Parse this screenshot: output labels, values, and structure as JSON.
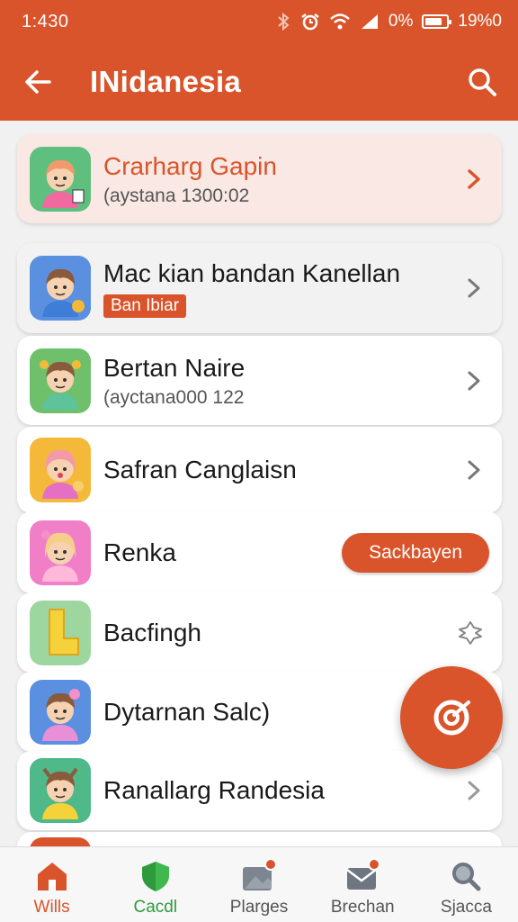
{
  "status_bar": {
    "time": "1:430",
    "battery_percent_label": "0%",
    "signal_label": "19%0",
    "icons": [
      "bluetooth-icon",
      "alarm-icon",
      "wifi-icon",
      "signal-icon",
      "battery-icon"
    ]
  },
  "header": {
    "title": "INidanesia",
    "back_icon": "arrow-left-icon",
    "search_icon": "search-icon"
  },
  "colors": {
    "accent": "#d9542b",
    "highlight_row": "#f9e8e3",
    "green": "#2f9a3c"
  },
  "list": {
    "items": [
      {
        "name": "Crarharg Gapin",
        "subtitle": "(aystana 1300:02",
        "trailing": "chevron-right-icon"
      },
      {
        "name": "Mac kian bandan Kanellan",
        "badge": "Ban Ibiar",
        "trailing": "chevron-right-icon"
      },
      {
        "name": "Bertan Naire",
        "subtitle": "(ayctana000 122",
        "trailing": "chevron-right-icon"
      },
      {
        "name": "Safran Canglaisn",
        "trailing": "chevron-right-icon"
      },
      {
        "name": "Renka",
        "action_label": "Sackbayen"
      },
      {
        "name": "Bacfingh",
        "trailing": "puzzle-icon"
      },
      {
        "name": "Dytarnan Salc)"
      },
      {
        "name": "Ranallarg Randesia",
        "trailing": "chevron-right-icon"
      }
    ]
  },
  "fab": {
    "icon": "target-icon"
  },
  "bottom_nav": {
    "items": [
      {
        "label": "Wills",
        "icon": "home-icon"
      },
      {
        "label": "Cacdl",
        "icon": "shield-icon"
      },
      {
        "label": "Plarges",
        "icon": "image-icon"
      },
      {
        "label": "Brechan",
        "icon": "mail-icon"
      },
      {
        "label": "Sjacca",
        "icon": "search-icon"
      }
    ]
  }
}
